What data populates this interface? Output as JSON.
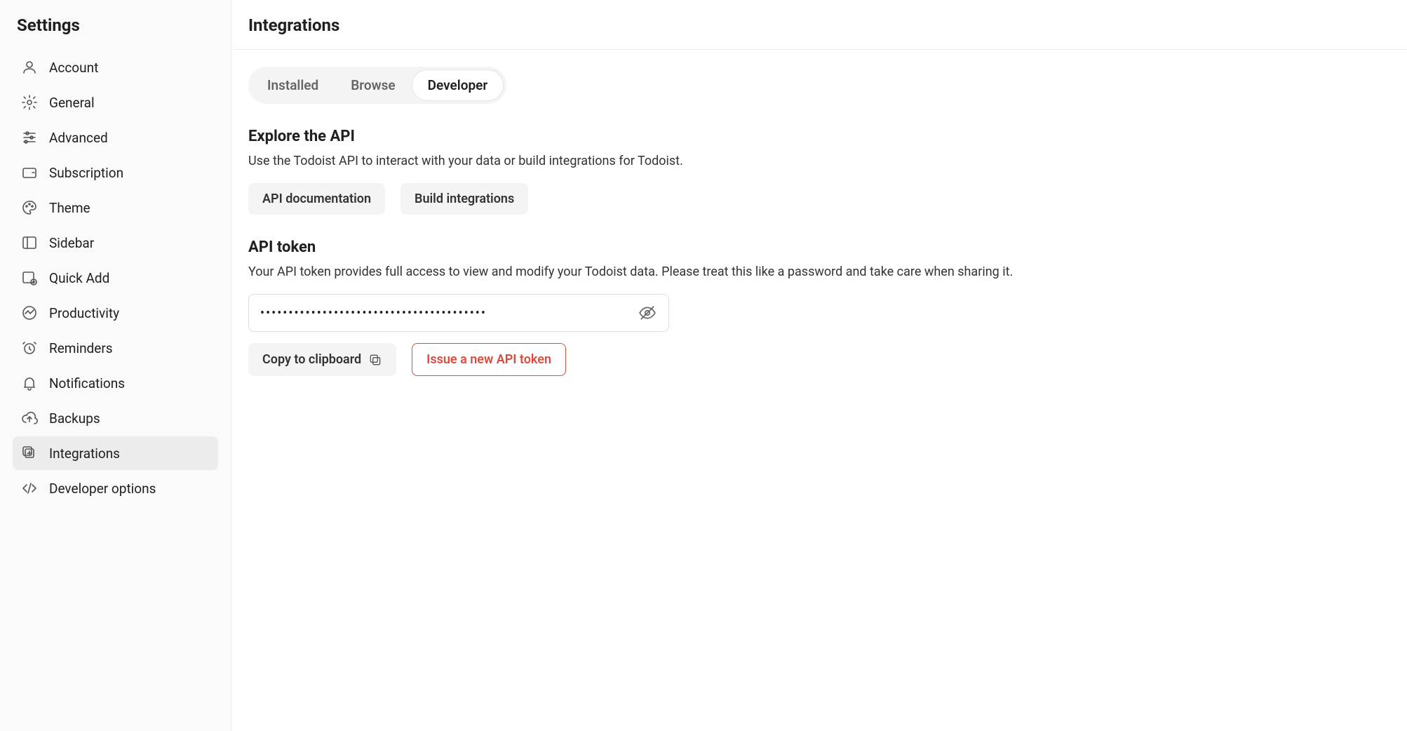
{
  "sidebar": {
    "title": "Settings",
    "items": [
      {
        "id": "account",
        "label": "Account",
        "icon": "user-icon",
        "active": false
      },
      {
        "id": "general",
        "label": "General",
        "icon": "gear-icon",
        "active": false
      },
      {
        "id": "advanced",
        "label": "Advanced",
        "icon": "sliders-icon",
        "active": false
      },
      {
        "id": "subscription",
        "label": "Subscription",
        "icon": "wallet-icon",
        "active": false
      },
      {
        "id": "theme",
        "label": "Theme",
        "icon": "palette-icon",
        "active": false
      },
      {
        "id": "sidebar",
        "label": "Sidebar",
        "icon": "layout-sidebar-icon",
        "active": false
      },
      {
        "id": "quick-add",
        "label": "Quick Add",
        "icon": "quick-add-icon",
        "active": false
      },
      {
        "id": "productivity",
        "label": "Productivity",
        "icon": "activity-icon",
        "active": false
      },
      {
        "id": "reminders",
        "label": "Reminders",
        "icon": "clock-icon",
        "active": false
      },
      {
        "id": "notifications",
        "label": "Notifications",
        "icon": "bell-icon",
        "active": false
      },
      {
        "id": "backups",
        "label": "Backups",
        "icon": "cloud-upload-icon",
        "active": false
      },
      {
        "id": "integrations",
        "label": "Integrations",
        "icon": "plugin-icon",
        "active": true
      },
      {
        "id": "developer-options",
        "label": "Developer options",
        "icon": "code-icon",
        "active": false
      }
    ]
  },
  "page": {
    "title": "Integrations",
    "tabs": [
      {
        "id": "installed",
        "label": "Installed",
        "active": false
      },
      {
        "id": "browse",
        "label": "Browse",
        "active": false
      },
      {
        "id": "developer",
        "label": "Developer",
        "active": true
      }
    ],
    "explore": {
      "heading": "Explore the API",
      "description": "Use the Todoist API to interact with your data or build integrations for Todoist.",
      "buttons": {
        "docs": "API documentation",
        "build": "Build integrations"
      }
    },
    "token": {
      "heading": "API token",
      "description": "Your API token provides full access to view and modify your Todoist data. Please treat this like a password and take care when sharing it.",
      "value_masked": "••••••••••••••••••••••••••••••••••••••••",
      "buttons": {
        "copy": "Copy to clipboard",
        "issue": "Issue a new API token"
      }
    }
  },
  "colors": {
    "danger": "#dc4c3e",
    "sidebar_bg": "#fafafa",
    "pill_bg": "#f4f4f4",
    "active_bg": "#ececec"
  }
}
